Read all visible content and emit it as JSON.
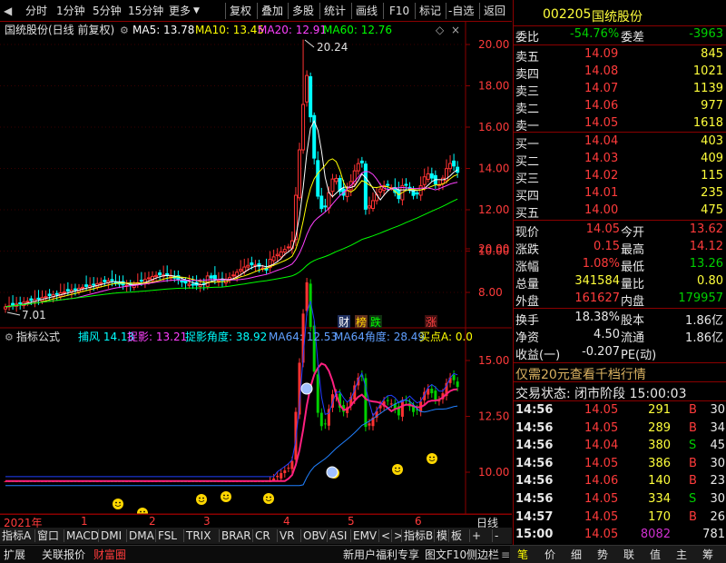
{
  "toolbar": {
    "leftarrow": "◀",
    "items": [
      "分时",
      "1分钟",
      "5分钟",
      "15分钟",
      "更多",
      "复权",
      "叠加",
      "多股",
      "统计",
      "画线",
      "F10",
      "标记",
      "-自选",
      "返回"
    ]
  },
  "stock": {
    "code": "002205",
    "name": "国统股份"
  },
  "main_chart": {
    "title": "国统股份(日线 前复权)",
    "ma5": "MA5: 13.78",
    "ma10": "MA10: 13.45",
    "ma20": "MA20: 12.91",
    "ma60": "MA60: 12.76",
    "high_label": "20.24",
    "low_label": "7.01",
    "badges": [
      "财",
      "榜",
      "跌",
      "涨"
    ],
    "yaxis": [
      "20.00",
      "18.00",
      "16.00",
      "14.00",
      "12.00",
      "10.00",
      "8.00"
    ],
    "colors": {
      "up": "#ff3232",
      "down": "#00ffff",
      "ma5": "#ffffff",
      "ma10": "#ffff00",
      "ma20": "#ff40ff",
      "ma60": "#00ff00"
    }
  },
  "indicator": {
    "title": "指标公式",
    "items": [
      "捕风 14.13",
      "捉影: 13.21",
      "捉影角度: 38.92",
      "MA64: 12.53",
      "MA64角度: 28.49",
      "买点A: 0.0"
    ],
    "yaxis": [
      "20.00",
      "15.00",
      "12.50",
      "10.00"
    ]
  },
  "xaxis": {
    "labels": [
      "2021年",
      "1",
      "2",
      "3",
      "4",
      "5",
      "6"
    ],
    "right": "日线"
  },
  "bottom_tabs": [
    "指标A",
    "窗口",
    "MACD",
    "DMI",
    "DMA",
    "FSL",
    "TRIX",
    "BRAR",
    "CR",
    "VR",
    "OBV",
    "ASI",
    "EMV",
    "<",
    ">",
    "指标B",
    "模",
    "板",
    "+",
    "-"
  ],
  "status_bar": {
    "left": [
      "扩展",
      "关联报价",
      "财富圈"
    ],
    "mid": [
      "新用户福利专享",
      "图文F10",
      "侧边栏"
    ],
    "nav": [
      "笔",
      "价",
      "细",
      "势",
      "联",
      "值",
      "主",
      "筹"
    ]
  },
  "quote": {
    "weibi": {
      "label": "委比",
      "value": "-54.76%",
      "label2": "委差",
      "value2": "-3963"
    },
    "sell": [
      {
        "label": "卖五",
        "price": "14.09",
        "vol": "845"
      },
      {
        "label": "卖四",
        "price": "14.08",
        "vol": "1021"
      },
      {
        "label": "卖三",
        "price": "14.07",
        "vol": "1139"
      },
      {
        "label": "卖二",
        "price": "14.06",
        "vol": "977"
      },
      {
        "label": "卖一",
        "price": "14.05",
        "vol": "1618"
      }
    ],
    "buy": [
      {
        "label": "买一",
        "price": "14.04",
        "vol": "403"
      },
      {
        "label": "买二",
        "price": "14.03",
        "vol": "409"
      },
      {
        "label": "买三",
        "price": "14.02",
        "vol": "115"
      },
      {
        "label": "买四",
        "price": "14.01",
        "vol": "235"
      },
      {
        "label": "买五",
        "price": "14.00",
        "vol": "475"
      }
    ],
    "stats": [
      {
        "l1": "现价",
        "v1": "14.05",
        "l2": "今开",
        "v2": "13.62",
        "c1": "red",
        "c2": "red"
      },
      {
        "l1": "涨跌",
        "v1": "0.15",
        "l2": "最高",
        "v2": "14.12",
        "c1": "red",
        "c2": "red"
      },
      {
        "l1": "涨幅",
        "v1": "1.08%",
        "l2": "最低",
        "v2": "13.26",
        "c1": "red",
        "c2": "grn"
      },
      {
        "l1": "总量",
        "v1": "341584",
        "l2": "量比",
        "v2": "0.80",
        "c1": "yel",
        "c2": "yel"
      },
      {
        "l1": "外盘",
        "v1": "161627",
        "l2": "内盘",
        "v2": "179957",
        "c1": "red",
        "c2": "grn"
      }
    ],
    "stats2": [
      {
        "l1": "换手",
        "v1": "18.38%",
        "l2": "股本",
        "v2": "1.86亿"
      },
      {
        "l1": "净资",
        "v1": "4.50",
        "l2": "流通",
        "v2": "1.86亿"
      },
      {
        "l1": "收益(一)",
        "v1": "-0.207",
        "l2": "PE(动)",
        "v2": ""
      }
    ],
    "promo": "仅需20元查看千档行情",
    "trade_state": "交易状态: 闭市阶段 15:00:03",
    "ticks": [
      {
        "t": "14:56",
        "p": "14.05",
        "v": "291",
        "bs": "B",
        "n": "30"
      },
      {
        "t": "14:56",
        "p": "14.05",
        "v": "289",
        "bs": "B",
        "n": "34"
      },
      {
        "t": "14:56",
        "p": "14.04",
        "v": "380",
        "bs": "S",
        "n": "45"
      },
      {
        "t": "14:56",
        "p": "14.05",
        "v": "386",
        "bs": "B",
        "n": "30"
      },
      {
        "t": "14:56",
        "p": "14.06",
        "v": "140",
        "bs": "B",
        "n": "23"
      },
      {
        "t": "14:56",
        "p": "14.05",
        "v": "334",
        "bs": "S",
        "n": "30"
      },
      {
        "t": "14:57",
        "p": "14.05",
        "v": "170",
        "bs": "B",
        "n": "26"
      },
      {
        "t": "15:00",
        "p": "14.05",
        "v": "8082",
        "bs": "",
        "n": "781"
      }
    ]
  }
}
